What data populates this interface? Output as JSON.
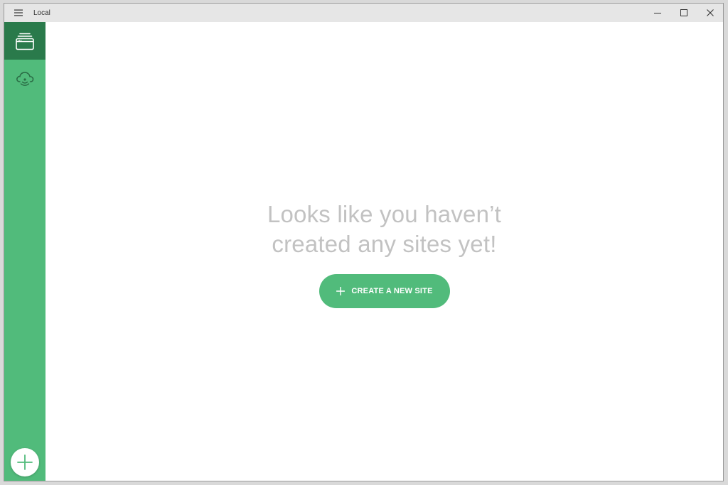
{
  "window": {
    "title": "Local"
  },
  "icons": {
    "menu": "hamburger-menu-icon",
    "minimize": "minimize-icon",
    "maximize": "maximize-icon",
    "close": "close-icon",
    "sites": "sites-stack-icon",
    "connect": "cloud-connect-icon",
    "add": "plus-icon"
  },
  "colors": {
    "accent": "#51bb7b",
    "accent_dark": "#2a7a4b",
    "empty_text": "#c2c2c2"
  },
  "main": {
    "empty_line1": "Looks like you haven’t",
    "empty_line2": "created any sites yet!",
    "create_button_label": "CREATE A NEW SITE"
  }
}
